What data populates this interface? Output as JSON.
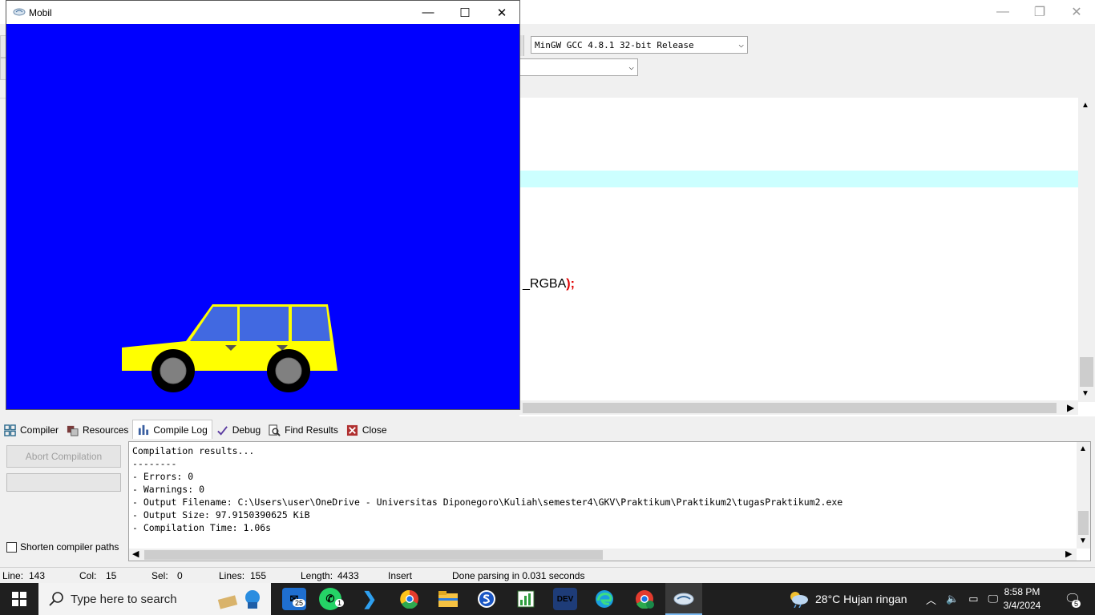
{
  "mobil_window": {
    "title": "Mobil",
    "controls": {
      "minimize": "—",
      "maximize": "☐",
      "close": "✕"
    },
    "colors": {
      "background": "#0000ff",
      "car_body": "#ffff00",
      "windows": "#4169e1",
      "tire": "#000000",
      "hubcap": "#808080"
    }
  },
  "devcpp": {
    "compiler_select": "MinGW GCC 4.8.1 32-bit Release",
    "code_fragment": {
      "text": "_RGBA",
      "close": ");"
    }
  },
  "tabs": [
    {
      "label": "Compiler",
      "icon": "grid-icon"
    },
    {
      "label": "Resources",
      "icon": "resources-icon"
    },
    {
      "label": "Compile Log",
      "icon": "chart-icon"
    },
    {
      "label": "Debug",
      "icon": "check-icon"
    },
    {
      "label": "Find Results",
      "icon": "find-icon"
    },
    {
      "label": "Close",
      "icon": "close-icon"
    }
  ],
  "compile_panel": {
    "abort_label": "Abort Compilation",
    "shorten_label": "Shorten compiler paths",
    "log": [
      "Compilation results...",
      "--------",
      "- Errors: 0",
      "- Warnings: 0",
      "- Output Filename: C:\\Users\\user\\OneDrive - Universitas Diponegoro\\Kuliah\\semester4\\GKV\\Praktikum\\Praktikum2\\tugasPraktikum2.exe",
      "- Output Size: 97.9150390625 KiB",
      "- Compilation Time: 1.06s"
    ]
  },
  "status": {
    "line_label": "Line:",
    "line": "143",
    "col_label": "Col:",
    "col": "15",
    "sel_label": "Sel:",
    "sel": "0",
    "lines_label": "Lines:",
    "lines": "155",
    "length_label": "Length:",
    "length": "4433",
    "mode": "Insert",
    "message": "Done parsing in 0.031 seconds"
  },
  "taskbar": {
    "search_placeholder": "Type here to search",
    "mail_badge": "25",
    "whatsapp_badge": "1",
    "weather": "28°C  Hujan ringan",
    "time": "8:58 PM",
    "date": "3/4/2024",
    "notification_count": "5"
  }
}
